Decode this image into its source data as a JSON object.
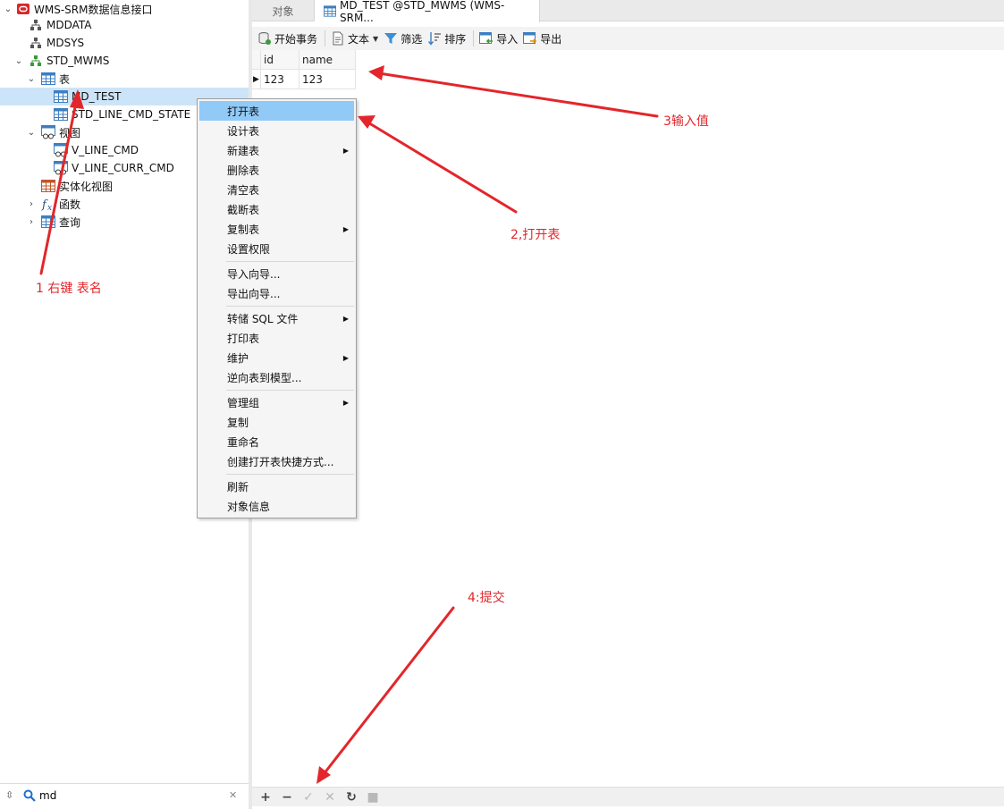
{
  "tree": {
    "connection": "WMS-SRM数据信息接口",
    "schemas": [
      "MDDATA",
      "MDSYS",
      "STD_MWMS"
    ],
    "tables_group": "表",
    "tables": [
      "MD_TEST",
      "STD_LINE_CMD_STATE"
    ],
    "views_group": "视图",
    "views": [
      "V_LINE_CMD",
      "V_LINE_CURR_CMD"
    ],
    "matviews_group": "实体化视图",
    "functions_group": "函数",
    "queries_group": "查询"
  },
  "search": {
    "value": "md"
  },
  "tabs": [
    "对象",
    "MD_TEST @STD_MWMS (WMS-SRM..."
  ],
  "toolbar": {
    "begin_tx": "开始事务",
    "text": "文本",
    "filter": "筛选",
    "sort": "排序",
    "import": "导入",
    "export": "导出"
  },
  "grid": {
    "columns": [
      "id",
      "name"
    ],
    "rows": [
      [
        "123",
        "123"
      ]
    ]
  },
  "context_menu": [
    "打开表",
    "设计表",
    "新建表",
    "删除表",
    "清空表",
    "截断表",
    "复制表",
    "设置权限",
    "导入向导...",
    "导出向导...",
    "转储 SQL 文件",
    "打印表",
    "维护",
    "逆向表到模型...",
    "管理组",
    "复制",
    "重命名",
    "创建打开表快捷方式...",
    "刷新",
    "对象信息"
  ],
  "annotations": {
    "step1": "1   右键 表名",
    "step2": "2,打开表",
    "step3": "3输入值",
    "step4": "4:提交"
  },
  "colors": {
    "annotation_red": "#e3262b",
    "selection_blue": "#cce4f7",
    "menu_highlight": "#91c9f7",
    "connection_red": "#d9262b",
    "schema_green": "#3a9a3a"
  }
}
